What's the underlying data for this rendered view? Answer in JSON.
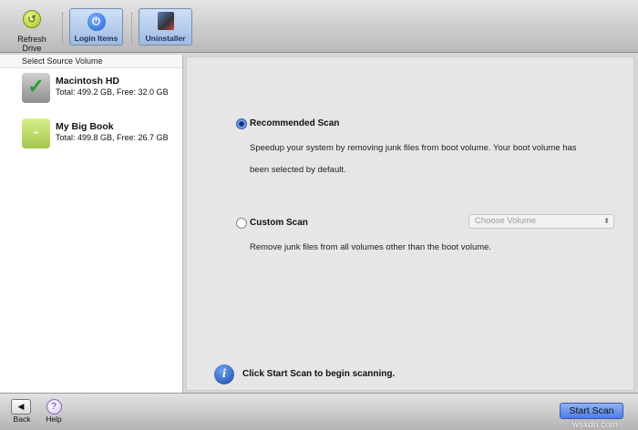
{
  "toolbar": {
    "refresh": "Refresh Drive",
    "login": "Login Items",
    "uninstaller": "Uninstaller"
  },
  "sidebar": {
    "header": "Select Source Volume",
    "volumes": [
      {
        "name": "Macintosh HD",
        "info": "Total: 499.2 GB, Free: 32.0 GB"
      },
      {
        "name": "My Big Book",
        "info": "Total: 499.8 GB, Free: 26.7 GB"
      }
    ]
  },
  "main": {
    "recommended": {
      "label": "Recommended Scan",
      "selected": true,
      "desc1": "Speedup your system by removing junk files from boot volume. Your boot volume has",
      "desc2": "been selected by default."
    },
    "custom": {
      "label": "Custom Scan",
      "selected": false,
      "desc": "Remove junk files from all volumes other than the boot volume.",
      "select_placeholder": "Choose Volume"
    },
    "info": "Click Start Scan to begin scanning."
  },
  "bottom": {
    "back": "Back",
    "help": "Help",
    "start": "Start Scan",
    "watermark": "wsxdn.com"
  }
}
